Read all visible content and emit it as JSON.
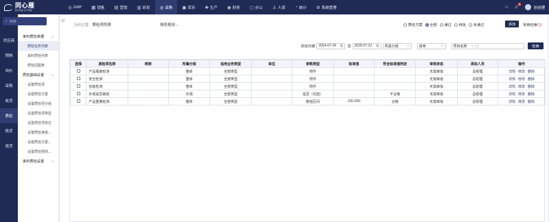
{
  "app": {
    "logo_main": "同心雁",
    "logo_sub": "数字智能·生产服务"
  },
  "topnav": [
    {
      "icon": "GMP-icon",
      "glyph": "◎",
      "label": "GMP"
    },
    {
      "icon": "sales-icon",
      "glyph": "▦",
      "label": "销售"
    },
    {
      "icon": "marketing-icon",
      "glyph": "▤",
      "label": "营销"
    },
    {
      "icon": "rnd-icon",
      "glyph": "▥",
      "label": "研发"
    },
    {
      "icon": "purchase-icon",
      "glyph": "◍",
      "label": "采购",
      "active": true
    },
    {
      "icon": "inventory-icon",
      "glyph": "▣",
      "label": "库存"
    },
    {
      "icon": "production-icon",
      "glyph": "✚",
      "label": "生产"
    },
    {
      "icon": "finance-icon",
      "glyph": "◉",
      "label": "财务"
    },
    {
      "icon": "office-icon",
      "glyph": "▢",
      "label": "办公"
    },
    {
      "icon": "hr-icon",
      "glyph": "♙",
      "label": "人资"
    },
    {
      "icon": "stats-icon",
      "glyph": "◔",
      "label": "统计"
    },
    {
      "icon": "system-icon",
      "glyph": "⚙",
      "label": "系统管理"
    }
  ],
  "topright": {
    "notif_count": "9",
    "user": "总经理"
  },
  "sidebar": {
    "search_placeholder": "搜索",
    "items": [
      {
        "label": "供应商"
      },
      {
        "label": "预购"
      },
      {
        "label": "询价"
      },
      {
        "label": "采购"
      },
      {
        "label": "收货"
      },
      {
        "label": "质检",
        "active": true
      },
      {
        "label": "换货"
      },
      {
        "label": "退货"
      }
    ]
  },
  "submenu": {
    "groups": [
      {
        "label": "来料质检单据",
        "caret": "∧",
        "items": [
          {
            "label": "质检任务列表",
            "active": true
          },
          {
            "label": "来料质检列表"
          },
          {
            "label": "质检回图表"
          }
        ]
      },
      {
        "label": "质检基础设置",
        "caret": "∧",
        "items": [
          {
            "label": "设置质检项"
          },
          {
            "label": "设置质检方案"
          },
          {
            "label": "设置质检项分组"
          },
          {
            "label": "设置质检项类型"
          },
          {
            "label": "设置质检项单位"
          },
          {
            "label": "设置质检准者..."
          },
          {
            "label": "设置质检方案..."
          },
          {
            "label": "设置质检规则..."
          }
        ]
      },
      {
        "label": "来料质检设置",
        "caret": "∨",
        "items": []
      }
    ]
  },
  "main": {
    "crumb_prefix": "当前位置:",
    "crumb_title": "质检项列表",
    "sort_rule": "排序规则",
    "radios": [
      {
        "label": "质检方案",
        "on": false
      },
      {
        "label": "全部",
        "on": true
      },
      {
        "label": "通过",
        "on": false
      },
      {
        "label": "待批",
        "on": false
      },
      {
        "label": "未通过",
        "on": false
      }
    ],
    "add_label": "添加",
    "common_search": "常用检索",
    "common_search_count": "(3)"
  },
  "filter": {
    "date_label": "添加日期",
    "date_from": "2024-07-24",
    "sep": "至",
    "date_to": "2025-07-23",
    "group_select": "所属分组",
    "enabled_select": "启用",
    "field_select": "项目名称",
    "keyword": "",
    "search_label": "检索"
  },
  "table": {
    "headers": [
      "选择",
      "质检项名称",
      "简称",
      "所属分组",
      "适用业务类型",
      "单位",
      "参数类型",
      "标准值",
      "符合标准值判定",
      "审核状态",
      "添加人员",
      "操作"
    ],
    "rows": [
      {
        "name": "产品瓶度检测",
        "abbr": "",
        "group": "整体",
        "biz": "全部类型",
        "unit": "",
        "param": "附件",
        "std": "",
        "judge": "",
        "status": "无需审批",
        "user": "总经理"
      },
      {
        "name": "安全检测",
        "abbr": "",
        "group": "整体",
        "biz": "全部类型",
        "unit": "",
        "param": "附件",
        "std": "",
        "judge": "",
        "status": "无需审批",
        "user": "总经理"
      },
      {
        "name": "包能检测",
        "abbr": "",
        "group": "整体",
        "biz": "全部类型",
        "unit": "",
        "param": "附件",
        "std": "",
        "judge": "",
        "status": "无需审批",
        "user": "总经理"
      },
      {
        "name": "外观是否破损",
        "abbr": "",
        "group": "外观",
        "biz": "全部类型",
        "unit": "",
        "param": "是否（勾选）",
        "std": "",
        "judge": "不合格",
        "status": "无需审批",
        "user": "总经理"
      },
      {
        "name": "产品重量检测",
        "abbr": "",
        "group": "整体",
        "biz": "全部类型",
        "unit": "",
        "param": "数值区间",
        "std": "100-300",
        "judge": "合格",
        "status": "无需审批",
        "user": "总经理"
      }
    ],
    "op_detail": "详情",
    "op_edit": "修改",
    "op_delete": "删除"
  }
}
